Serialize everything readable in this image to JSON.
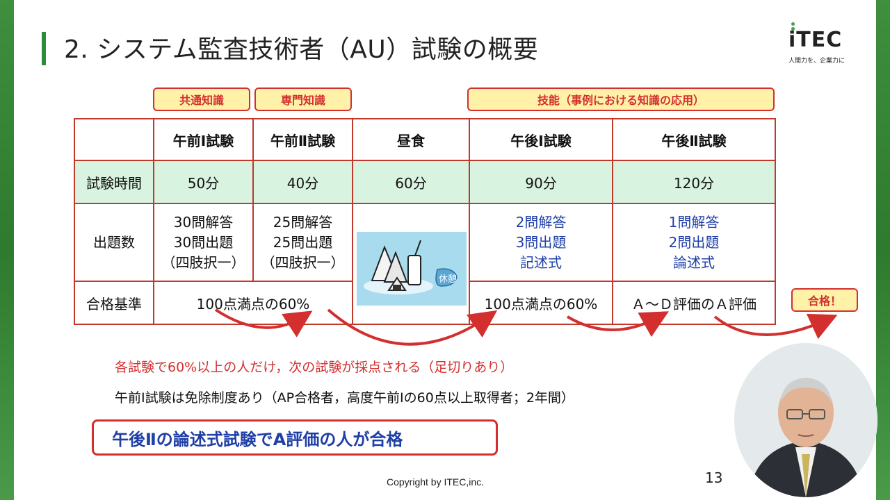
{
  "slide": {
    "title": "2. システム監査技術者（AU）試験の概要",
    "logo": {
      "text": "iTEC",
      "subtitle": "人間力を、企業力に"
    }
  },
  "tags": {
    "common": "共通知識",
    "specialized": "専門知識",
    "skill": "技能（事例における知識の応用）",
    "pass": "合格！"
  },
  "table": {
    "headers": [
      "",
      "午前Ⅰ試験",
      "午前Ⅱ試験",
      "昼食",
      "午後Ⅰ試験",
      "午後Ⅱ試験"
    ],
    "time_row": {
      "label": "試験時間",
      "values": [
        "50分",
        "40分",
        "60分",
        "90分",
        "120分"
      ]
    },
    "count_row": {
      "label": "出題数",
      "am1": [
        "30問解答",
        "30問出題",
        "（四肢択一）"
      ],
      "am2": [
        "25問解答",
        "25問出題",
        "（四肢択一）"
      ],
      "pm1": [
        "2問解答",
        "3問出題",
        "記述式"
      ],
      "pm2": [
        "1問解答",
        "2問出題",
        "論述式"
      ]
    },
    "pass_row": {
      "label": "合格基準",
      "am": "100点満点の60%",
      "pm1": "100点満点の60%",
      "pm2": "Ａ～Ｄ評価のＡ評価"
    },
    "lunch_badge": "休憩"
  },
  "notes": {
    "cutoff": "各試験で60%以上の人だけ，次の試験が採点される（足切りあり）",
    "exemption": "午前Ⅰ試験は免除制度あり（AP合格者，高度午前Ⅰの60点以上取得者；2年間）"
  },
  "callout": "午後Ⅱの論述式試験でA評価の人が合格",
  "footer": {
    "copyright": "Copyright by ITEC,inc.",
    "page": "13"
  },
  "colors": {
    "accent_red": "#d32f2f",
    "green_band": "#d8f3df",
    "tag_fill": "#fff2a8",
    "blue_text": "#1f3fa8",
    "brand_green": "#2e8b3a"
  }
}
